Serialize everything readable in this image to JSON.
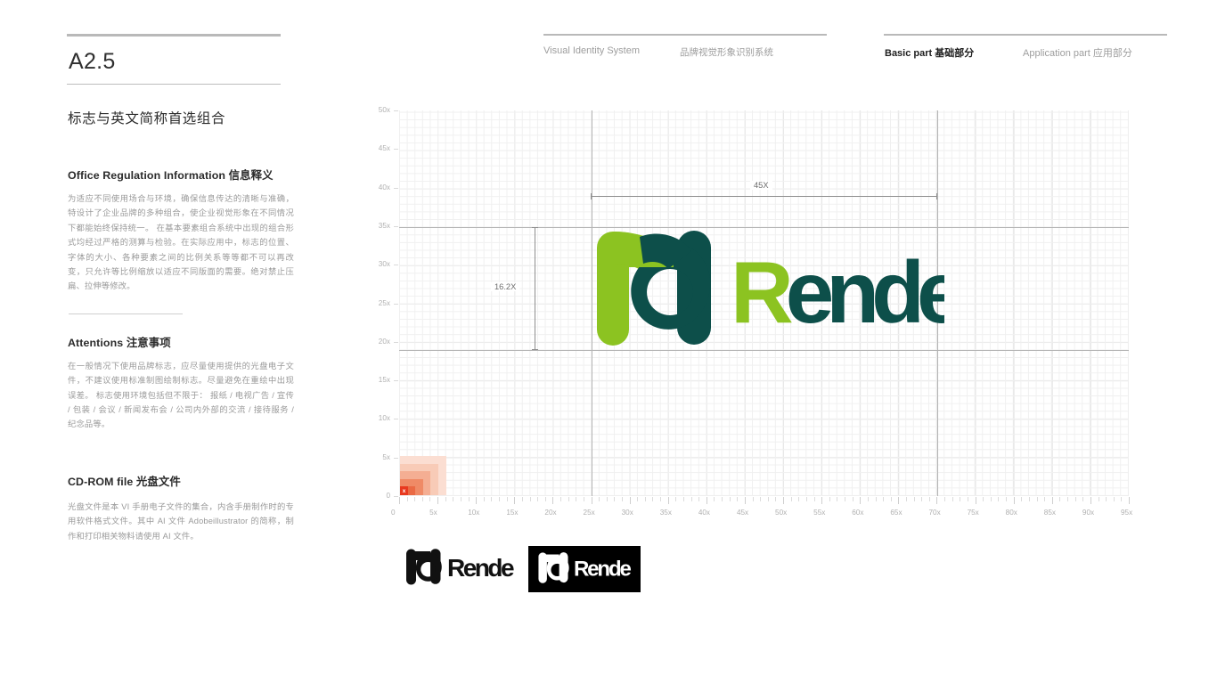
{
  "left": {
    "code": "A2.5",
    "subtitle": "标志与英文简称首选组合",
    "sections": [
      {
        "heading_en": "Office Regulation Information",
        "heading_cn": "信息释义",
        "body": "为适应不同使用场合与环境，确保信息传达的清晰与准确，特设计了企业品牌的多种组合，使企业视觉形象在不同情况下都能始终保持统一。\n在基本要素组合系统中出现的组合形式均经过严格的测算与检验。在实际应用中，标志的位置、字体的大小、各种要素之间的比例关系等等都不可以再改变，只允许等比例缩放以适应不同版面的需要。绝对禁止压扁、拉伸等修改。"
      },
      {
        "heading_en": "Attentions",
        "heading_cn": "注意事项",
        "body": "在一般情况下使用品牌标志，应尽量使用提供的光盘电子文件，不建议使用标准制图绘制标志。尽量避免在重绘中出现误差。\n标志使用环境包括但不限于：\n报纸 / 电视广告 / 宣传 / 包装 / 会议 / 新闻发布会 / 公司内外部的交流 / 接待服务 / 纪念品等。"
      },
      {
        "heading_en": "CD-ROM file",
        "heading_cn": "光盘文件",
        "body": "光盘文件是本 VI 手册电子文件的集合，内含手册制作时的专用软件格式文件。其中 AI 文件 Adobeillustrator 的简称，制作和打印相关物料请使用 AI 文件。"
      }
    ]
  },
  "header": {
    "items": [
      {
        "en": "Visual Identity System",
        "cn": ""
      },
      {
        "en": "",
        "cn": "品牌视觉形象识别系统"
      },
      {
        "en": "Basic part",
        "cn": "基础部分",
        "active": true
      },
      {
        "en": "Application part",
        "cn": "应用部分",
        "active": false
      }
    ],
    "item1": "Visual Identity System",
    "item2": "品牌视觉形象识别系统",
    "item3_en": "Basic part",
    "item3_cn": "基础部分",
    "item4_en": "Application part",
    "item4_cn": "应用部分"
  },
  "chart_data": {
    "type": "scatter",
    "title": "",
    "xlabel": "",
    "ylabel": "",
    "x_ticks": [
      "0",
      "5x",
      "10x",
      "15x",
      "20x",
      "25x",
      "30x",
      "35x",
      "40x",
      "45x",
      "50x",
      "55x",
      "60x",
      "65x",
      "70x",
      "75x",
      "80x",
      "85x",
      "90x",
      "95x"
    ],
    "y_ticks": [
      "0",
      "5x",
      "10x",
      "15x",
      "20x",
      "25x",
      "30x",
      "35x",
      "40x",
      "45x",
      "50x"
    ],
    "xlim": [
      0,
      95
    ],
    "ylim": [
      0,
      50
    ],
    "grid": true,
    "minor_step": 1,
    "major_step": 5,
    "guides_v": [
      25,
      70
    ],
    "guides_h": [
      19,
      35
    ],
    "annotations": [
      {
        "label": "45X",
        "type": "horizontal-dimension",
        "from_x": 25,
        "to_x": 70,
        "at_y": 40
      },
      {
        "label": "16.2X",
        "type": "vertical-dimension",
        "at_x": 18,
        "from_y": 19,
        "to_y": 35
      }
    ],
    "origin_marker": {
      "label": "x",
      "size": 1,
      "steps": [
        1,
        2,
        3,
        4,
        5
      ]
    },
    "unit_note": ""
  },
  "grid_labels": {
    "dim_width": "45X",
    "dim_height": "16.2X",
    "origin_unit": "x"
  },
  "logo": {
    "wordmark": "Rende",
    "mark_name": "rd-monogram",
    "colors": {
      "green": "#8cc321",
      "teal": "#0d4f4a",
      "black": "#000000",
      "white": "#ffffff",
      "accent_red": "#e8391f"
    }
  },
  "variants": [
    {
      "name": "logo-black-on-white",
      "wordmark": "Rende"
    },
    {
      "name": "logo-white-on-black",
      "wordmark": "Rende"
    }
  ]
}
